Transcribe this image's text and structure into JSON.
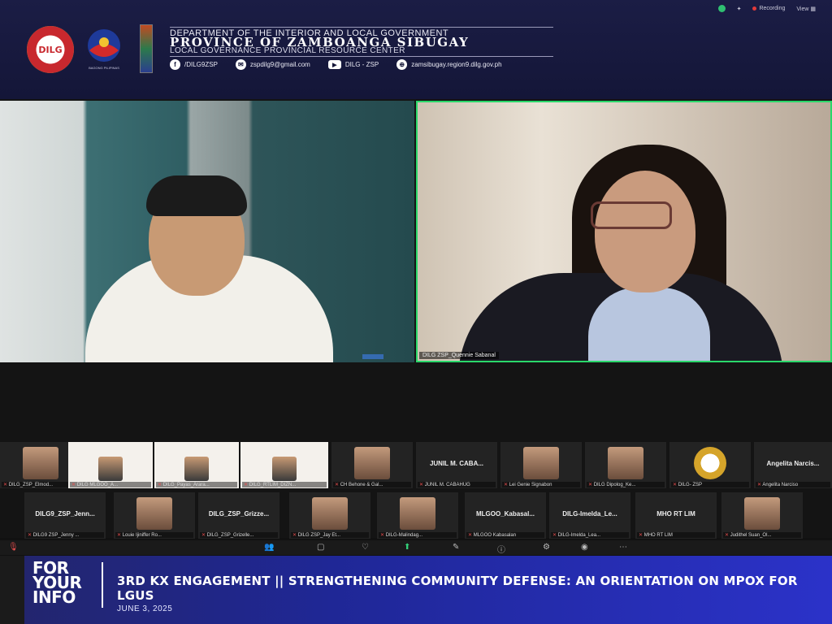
{
  "zoom_top": {
    "recording": "Recording",
    "view": "View"
  },
  "header": {
    "logo_dilg_text": "DILG",
    "bagong_pilipinas": "BAGONG PILIPINAS",
    "line1": "DEPARTMENT OF THE INTERIOR AND LOCAL GOVERNMENT",
    "line2": "PROVINCE OF ZAMBOANGA SIBUGAY",
    "line3": "LOCAL GOVERNANCE PROVINCIAL RESOURCE CENTER",
    "contacts": {
      "facebook": "/DILG9ZSP",
      "email": "zspdilg9@gmail.com",
      "youtube": "DILG - ZSP",
      "website": "zamsibugay.region9.dilg.gov.ph"
    }
  },
  "video": {
    "right_name": "DILG ZSP_Quennie Sabanal"
  },
  "gallery": {
    "row1": [
      {
        "small": "DILG_ZSP_Elmod..."
      },
      {
        "small": "DILG MLGOO_A..."
      },
      {
        "small": "DILG_Payas_Arara..."
      },
      {
        "small": "DILG_RTLIM_DIZN..."
      },
      {
        "small": "CH Behone & Gal..."
      },
      {
        "big": "JUNIL M. CABA...",
        "small": "JUNIL M. CABAHUG"
      },
      {
        "small": "Lei Genie Signabon"
      },
      {
        "small": "DILG Dipolog_Ke..."
      },
      {
        "small": "DILG- ZSP"
      },
      {
        "big": "Angelita Narcis...",
        "small": "Angelita Narciso"
      }
    ],
    "row2": [
      {
        "big": "DILG9_ZSP_Jenn...",
        "small": "DILG9 ZSP_Jenny ..."
      },
      {
        "small": "Louie Ijiniffer Ro..."
      },
      {
        "big": "DILG_ZSP_Grizze...",
        "small": "DILG_ZSP_Grizelle..."
      },
      {
        "small": "DILG ZSP_Jay Et..."
      },
      {
        "small": "DILG-Malindag..."
      },
      {
        "big": "MLGOO_Kabasal...",
        "small": "MLGOO Kabasalan"
      },
      {
        "big": "DILG-Imelda_Le...",
        "small": "DILG-Imelda_Lea..."
      },
      {
        "big": "MHO RT LIM",
        "small": "MHO RT LIM"
      },
      {
        "small": "Judithel Suan_Ol..."
      }
    ]
  },
  "caption": {
    "fyi": [
      "FOR",
      "YOUR",
      "INFO"
    ],
    "title": "3RD KX ENGAGEMENT || STRENGTHENING COMMUNITY DEFENSE: AN ORIENTATION ON MPOX FOR LGUS",
    "date": "JUNE 3, 2025"
  },
  "colors": {
    "banner": "#141638",
    "caption": "#2b32c9",
    "active_speaker": "#2ad86a"
  }
}
